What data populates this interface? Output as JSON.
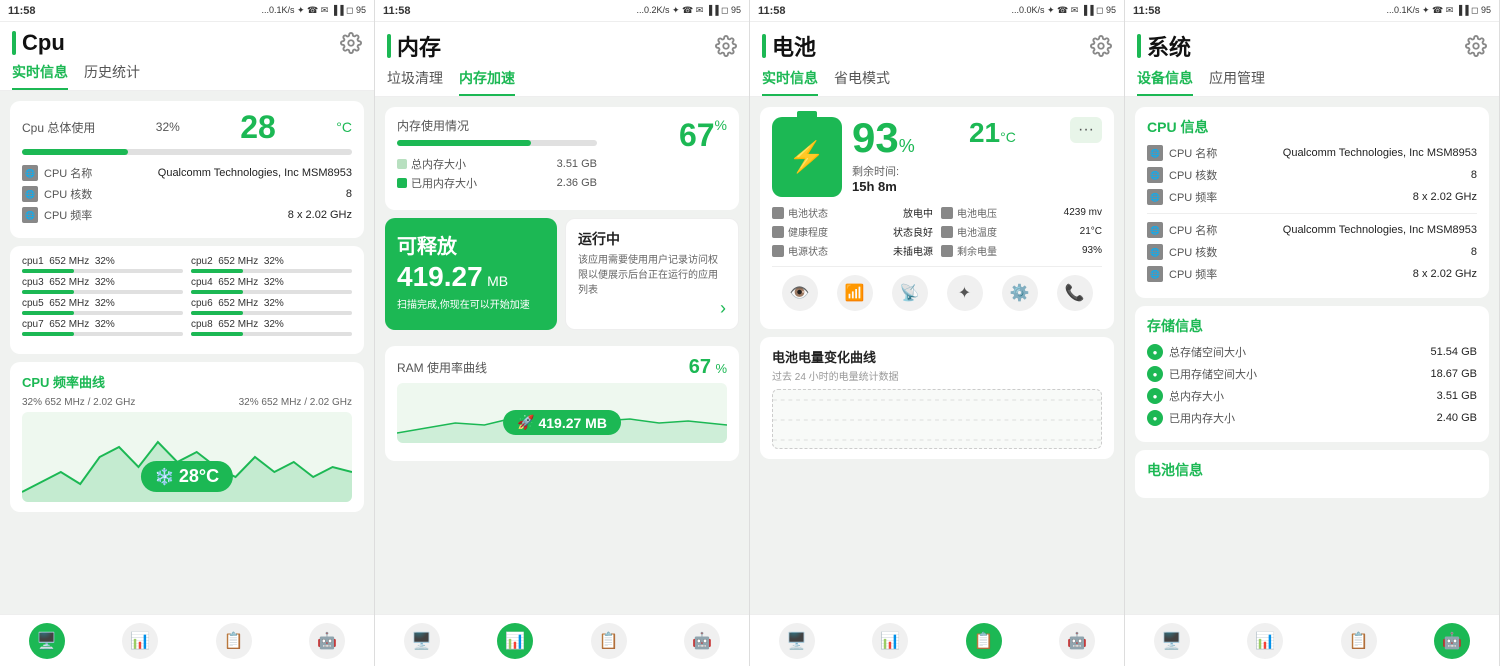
{
  "panels": [
    {
      "id": "cpu",
      "statusBar": {
        "time": "11:58",
        "signal": "...0.1K/s ✦ ☎ ✉ ▐▐▐ ◻ 95"
      },
      "title": "Cpu",
      "tabs": [
        "实时信息",
        "历史统计"
      ],
      "activeTab": 0,
      "usageLabel": "Cpu 总体使用",
      "usagePct": "32%",
      "tempValue": "28",
      "tempUnit": "°C",
      "cpuInfo": [
        {
          "label": "CPU 名称",
          "value": "Qualcomm Technologies, Inc MSM8953"
        },
        {
          "label": "CPU 核数",
          "value": "8"
        },
        {
          "label": "CPU 频率",
          "value": "8 x 2.02 GHz"
        }
      ],
      "cores": [
        {
          "name": "cpu1",
          "freq": "652 MHz",
          "pct": "32%",
          "fill": 32
        },
        {
          "name": "cpu2",
          "freq": "652 MHz",
          "pct": "32%",
          "fill": 32
        },
        {
          "name": "cpu3",
          "freq": "652 MHz",
          "pct": "32%",
          "fill": 32
        },
        {
          "name": "cpu4",
          "freq": "652 MHz",
          "pct": "32%",
          "fill": 32
        },
        {
          "name": "cpu5",
          "freq": "652 MHz",
          "pct": "32%",
          "fill": 32
        },
        {
          "name": "cpu6",
          "freq": "652 MHz",
          "pct": "32%",
          "fill": 32
        },
        {
          "name": "cpu7",
          "freq": "652 MHz",
          "pct": "32%",
          "fill": 32
        },
        {
          "name": "cpu8",
          "freq": "652 MHz",
          "pct": "32%",
          "fill": 32
        }
      ],
      "freqSection": {
        "title": "CPU 频率曲线",
        "meta1": "32%  652 MHz / 2.02 GHz",
        "meta2": "32%  652 MHz / 2.02 GHz",
        "tempBubble": "28°C"
      },
      "bottomNav": [
        "🖥️",
        "📊",
        "📋",
        "🤖"
      ]
    },
    {
      "id": "memory",
      "statusBar": {
        "time": "11:58",
        "signal": "...0.2K/s ✦ ☎ ✉ ▐▐▐ ◻ 95"
      },
      "title": "内存",
      "tabs": [
        "垃圾清理",
        "内存加速"
      ],
      "activeTab": 1,
      "usageLabel": "内存使用情况",
      "usagePct": "67",
      "usageUnit": "%",
      "totalLabel": "总内存大小",
      "totalValue": "3.51 GB",
      "usedLabel": "已用内存大小",
      "usedValue": "2.36 GB",
      "releaseCard": {
        "title": "可释放",
        "size": "419.27",
        "unit": "MB",
        "sub": "扫描完成,你现在可以开始加速"
      },
      "runningCard": {
        "title": "运行中",
        "desc": "该应用需要使用用户记录访问权限以便展示后台正在运行的应用列表"
      },
      "ramChart": {
        "title": "RAM 使用率曲线",
        "pct": "67",
        "unit": "%",
        "bubble": "419.27 MB"
      },
      "bottomNav": [
        "🖥️",
        "📊",
        "📋",
        "🤖"
      ]
    },
    {
      "id": "battery",
      "statusBar": {
        "time": "11:58",
        "signal": "...0.0K/s ✦ ☎ ✉ ▐▐▐ ◻ 95"
      },
      "title": "电池",
      "tabs": [
        "实时信息",
        "省电模式"
      ],
      "activeTab": 0,
      "batteryPct": "93",
      "batteryUnit": "%",
      "tempValue": "21",
      "tempUnit": "°C",
      "remaining": "剩余时间:",
      "remainingTime": "15h 8m",
      "batteryInfo": [
        {
          "label": "电池状态",
          "value": "放电中"
        },
        {
          "label": "电池电压",
          "value": "4239 mv"
        },
        {
          "label": "健康程度",
          "value": "状态良好"
        },
        {
          "label": "电池温度",
          "value": "21°C"
        },
        {
          "label": "电源状态",
          "value": "未插电源"
        },
        {
          "label": "剩余电量",
          "value": "93%"
        }
      ],
      "quickIcons": [
        "👁️",
        "📶",
        "📡",
        "✦",
        "⚙️",
        "📞"
      ],
      "chartTitle": "电池电量变化曲线",
      "chartSub": "过去 24 小时的电量统计数据",
      "bottomNav": [
        "🖥️",
        "📊",
        "📋",
        "🤖"
      ]
    },
    {
      "id": "system",
      "statusBar": {
        "time": "11:58",
        "signal": "...0.1K/s ✦ ☎ ✉ ▐▐▐ ◻ 95"
      },
      "title": "系统",
      "tabs": [
        "设备信息",
        "应用管理"
      ],
      "activeTab": 0,
      "cpuInfoSection": {
        "title": "CPU 信息",
        "items": [
          {
            "label": "CPU 名称",
            "value": "Qualcomm Technologies, Inc MSM8953"
          },
          {
            "label": "CPU 核数",
            "value": "8"
          },
          {
            "label": "CPU 频率",
            "value": "8 x 2.02 GHz"
          },
          {
            "label": "CPU 名称",
            "value": "Qualcomm Technologies, Inc MSM8953"
          },
          {
            "label": "CPU 核数",
            "value": "8"
          },
          {
            "label": "CPU 频率",
            "value": "8 x 2.02 GHz"
          }
        ]
      },
      "storageSection": {
        "title": "存储信息",
        "items": [
          {
            "label": "总存储空间大小",
            "value": "51.54 GB"
          },
          {
            "label": "已用存储空间大小",
            "value": "18.67 GB"
          },
          {
            "label": "总内存大小",
            "value": "3.51 GB"
          },
          {
            "label": "已用内存大小",
            "value": "2.40 GB"
          }
        ]
      },
      "batterySection": {
        "title": "电池信息",
        "items": []
      },
      "bottomNav": [
        "🖥️",
        "📊",
        "📋",
        "🤖"
      ]
    }
  ],
  "accentColor": "#1cb854"
}
